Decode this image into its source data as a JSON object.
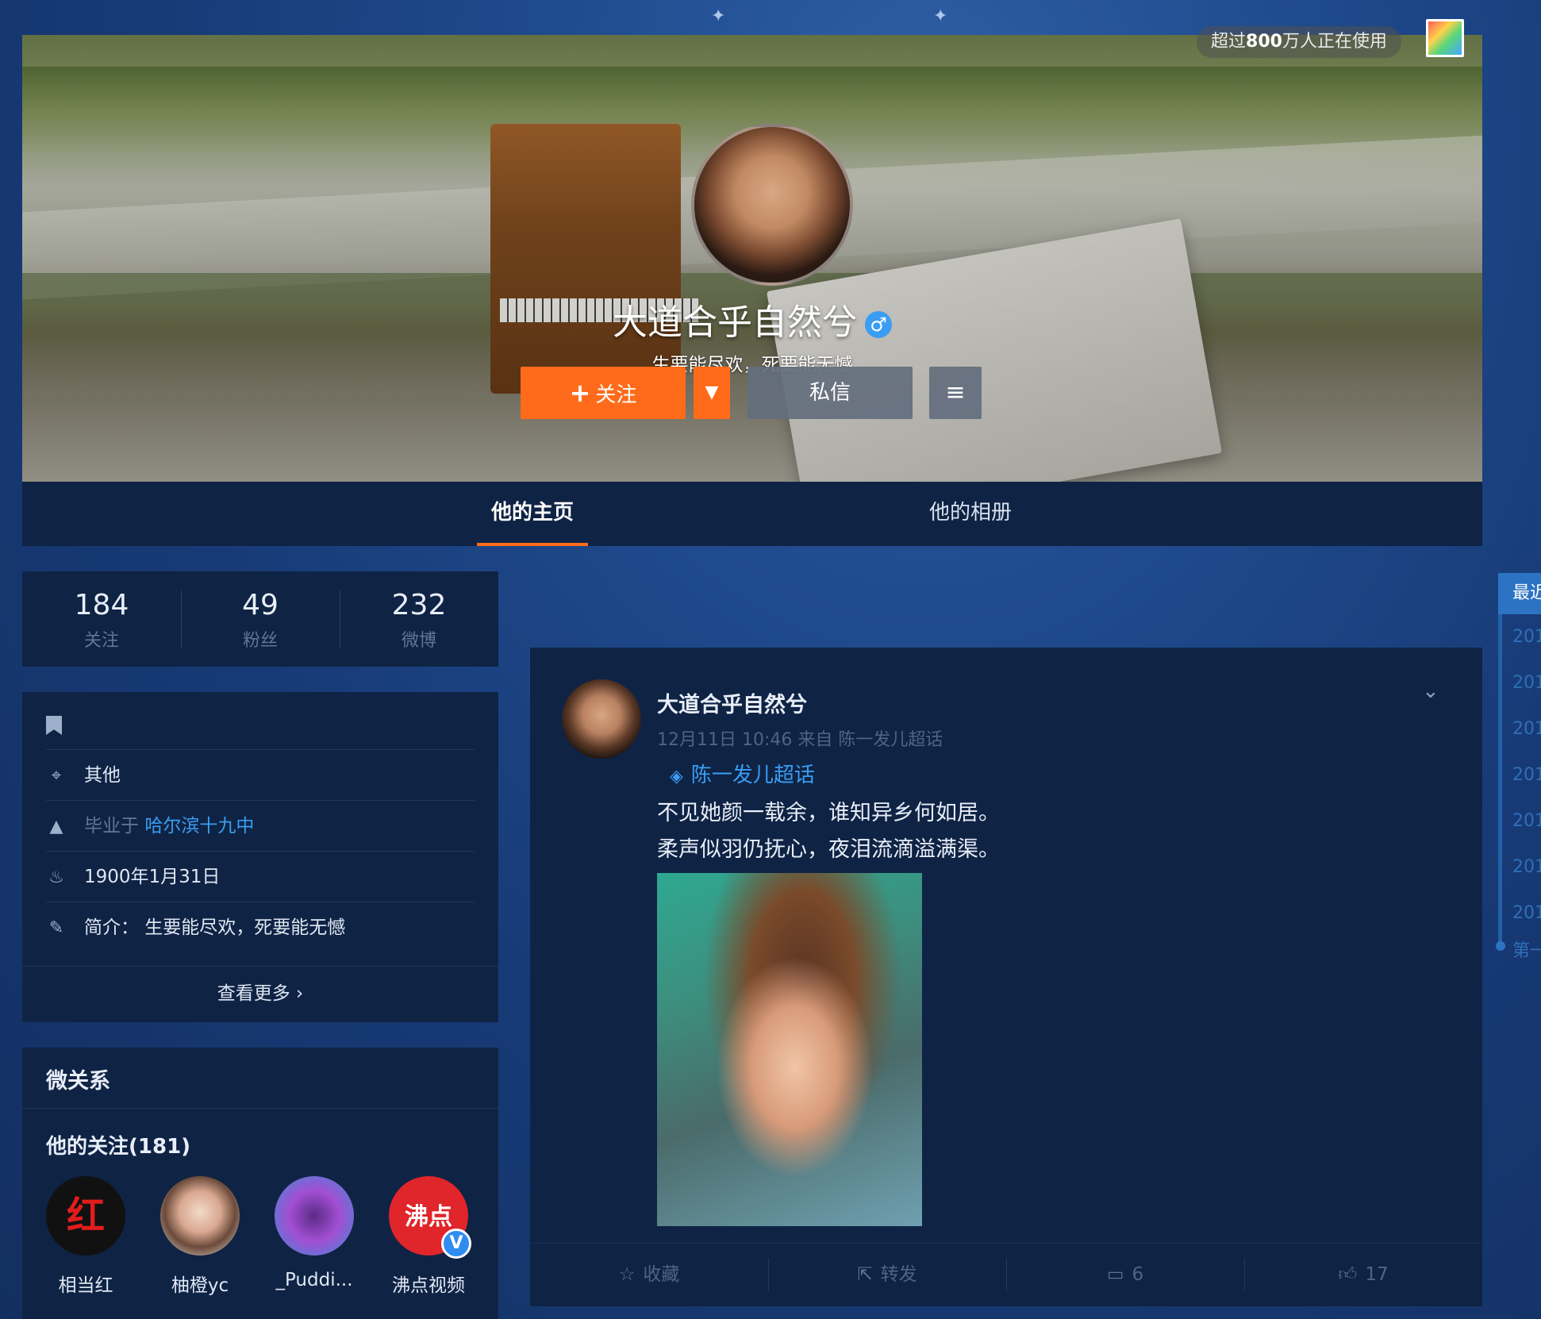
{
  "cover": {
    "users_badge_prefix": "超过",
    "users_badge_number": "800",
    "users_badge_suffix": "万人正在使用",
    "profile_name": "大道合乎自然兮",
    "gender_symbol": "♂",
    "motto": "生要能尽欢，死要能无憾",
    "follow_label": "关注",
    "message_label": "私信"
  },
  "tabs": {
    "home": "他的主页",
    "album": "他的相册"
  },
  "stats": [
    {
      "value": "184",
      "label": "关注"
    },
    {
      "value": "49",
      "label": "粉丝"
    },
    {
      "value": "232",
      "label": "微博"
    }
  ],
  "info": {
    "location": "其他",
    "edu_prefix": "毕业于",
    "school": "哈尔滨十九中",
    "birthday": "1900年1月31日",
    "bio": "简介：  生要能尽欢，死要能无憾",
    "more": "查看更多"
  },
  "relations": {
    "title": "微关系",
    "following_title": "他的关注(181)",
    "users": [
      {
        "name": "相当红",
        "avatar_text": "红"
      },
      {
        "name": "柚橙yc"
      },
      {
        "name": "_Puddi..."
      },
      {
        "name": "沸点视频",
        "avatar_text": "沸点"
      }
    ]
  },
  "post": {
    "author": "大道合乎自然兮",
    "meta": "12月11日 10:46 来自 陈一发儿超话",
    "topic": "陈一发儿超话",
    "line1": "不见她颜一载余，谁知异乡何如居。",
    "line2": "柔声似羽仍抚心，夜泪流滴溢满渠。",
    "actions": {
      "favorite": "收藏",
      "repost": "转发",
      "comments": "6",
      "likes": "17"
    }
  },
  "timeline": {
    "head": "最近",
    "items": [
      "201",
      "201",
      "201",
      "201",
      "201",
      "201",
      "201",
      "第一"
    ]
  }
}
